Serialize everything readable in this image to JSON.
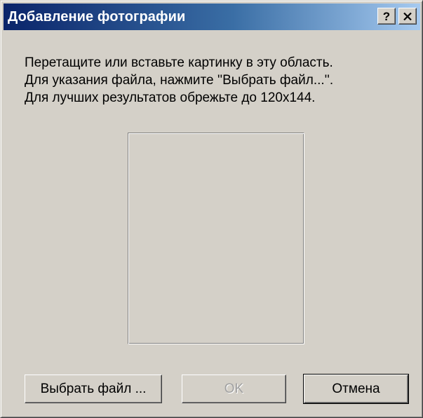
{
  "dialog": {
    "title": "Добавление фотографии",
    "help_label": "?",
    "close_icon": "close-icon"
  },
  "instructions": {
    "line1": "Перетащите или вставьте картинку в эту область.",
    "line2": "Для указания файла, нажмите ''Выбрать файл...''.",
    "line3": "Для лучших результатов обрежьте до 120x144."
  },
  "buttons": {
    "choose_file": "Выбрать файл ...",
    "ok": "OK",
    "ok_enabled": false,
    "cancel": "Отмена"
  },
  "colors": {
    "title_gradient_start": "#0a246a",
    "title_gradient_end": "#a6caf0",
    "face": "#d4d0c8"
  }
}
